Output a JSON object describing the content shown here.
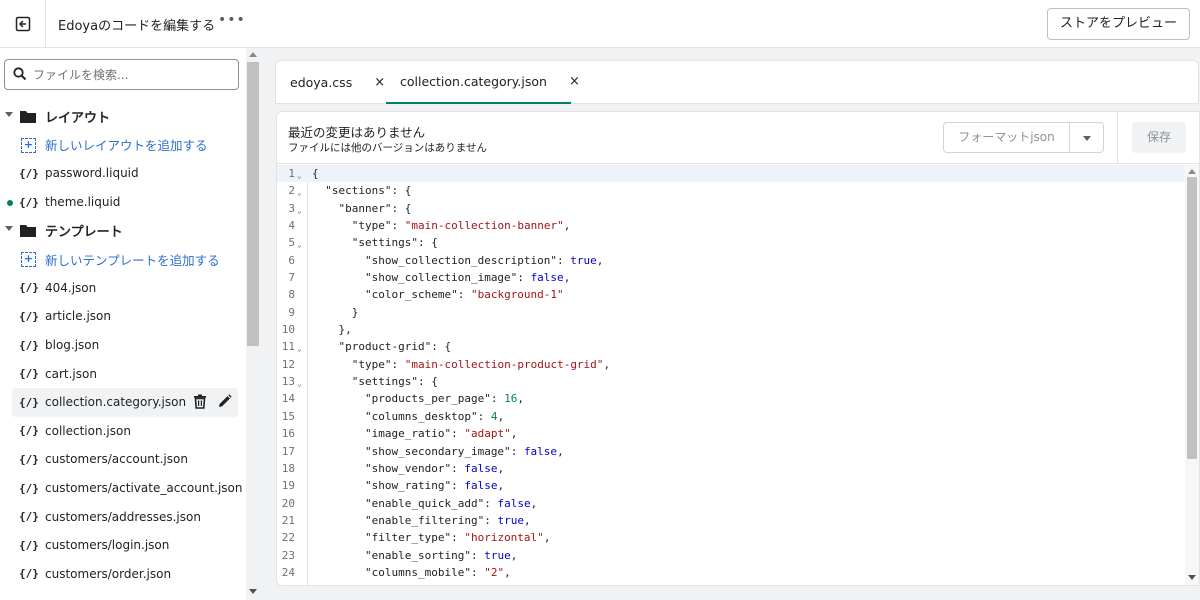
{
  "header": {
    "title": "Edoyaのコードを編集する",
    "more_label": "•••",
    "preview_label": "ストアをプレビュー"
  },
  "search": {
    "placeholder": "ファイルを検索..."
  },
  "sidebar": {
    "layout_folder": "レイアウト",
    "add_layout": "新しいレイアウトを追加する",
    "layout_files": [
      "password.liquid",
      "theme.liquid"
    ],
    "templates_folder": "テンプレート",
    "add_template": "新しいテンプレートを追加する",
    "template_files": [
      "404.json",
      "article.json",
      "blog.json",
      "cart.json",
      "collection.category.json",
      "collection.json",
      "customers/account.json",
      "customers/activate_account.json",
      "customers/addresses.json",
      "customers/login.json",
      "customers/order.json"
    ],
    "file_icon": "{/}",
    "add_icon": "+"
  },
  "tabs": [
    {
      "label": "edoya.css",
      "close": "×"
    },
    {
      "label": "collection.category.json",
      "close": "×"
    }
  ],
  "editor": {
    "status_title": "最近の変更はありません",
    "status_sub": "ファイルには他のバージョンはありません",
    "format_label": "フォーマットjson",
    "save_label": "保存"
  },
  "code_lines": [
    {
      "n": "1",
      "fold": true,
      "t": "{"
    },
    {
      "n": "2",
      "fold": true,
      "t": "  \"sections\": {"
    },
    {
      "n": "3",
      "fold": true,
      "t": "    \"banner\": {"
    },
    {
      "n": "4",
      "fold": false,
      "t": "      \"type\": \"main-collection-banner\","
    },
    {
      "n": "5",
      "fold": true,
      "t": "      \"settings\": {"
    },
    {
      "n": "6",
      "fold": false,
      "t": "        \"show_collection_description\": true,"
    },
    {
      "n": "7",
      "fold": false,
      "t": "        \"show_collection_image\": false,"
    },
    {
      "n": "8",
      "fold": false,
      "t": "        \"color_scheme\": \"background-1\""
    },
    {
      "n": "9",
      "fold": false,
      "t": "      }"
    },
    {
      "n": "10",
      "fold": false,
      "t": "    },"
    },
    {
      "n": "11",
      "fold": true,
      "t": "    \"product-grid\": {"
    },
    {
      "n": "12",
      "fold": false,
      "t": "      \"type\": \"main-collection-product-grid\","
    },
    {
      "n": "13",
      "fold": true,
      "t": "      \"settings\": {"
    },
    {
      "n": "14",
      "fold": false,
      "t": "        \"products_per_page\": 16,"
    },
    {
      "n": "15",
      "fold": false,
      "t": "        \"columns_desktop\": 4,"
    },
    {
      "n": "16",
      "fold": false,
      "t": "        \"image_ratio\": \"adapt\","
    },
    {
      "n": "17",
      "fold": false,
      "t": "        \"show_secondary_image\": false,"
    },
    {
      "n": "18",
      "fold": false,
      "t": "        \"show_vendor\": false,"
    },
    {
      "n": "19",
      "fold": false,
      "t": "        \"show_rating\": false,"
    },
    {
      "n": "20",
      "fold": false,
      "t": "        \"enable_quick_add\": false,"
    },
    {
      "n": "21",
      "fold": false,
      "t": "        \"enable_filtering\": true,"
    },
    {
      "n": "22",
      "fold": false,
      "t": "        \"filter_type\": \"horizontal\","
    },
    {
      "n": "23",
      "fold": false,
      "t": "        \"enable_sorting\": true,"
    },
    {
      "n": "24",
      "fold": false,
      "t": "        \"columns_mobile\": \"2\","
    }
  ],
  "colors": {
    "accent_green": "#008060",
    "link_blue": "#2c6ecb",
    "string_red": "#a31515",
    "bool_blue": "#0000cc",
    "number_green": "#098658"
  }
}
